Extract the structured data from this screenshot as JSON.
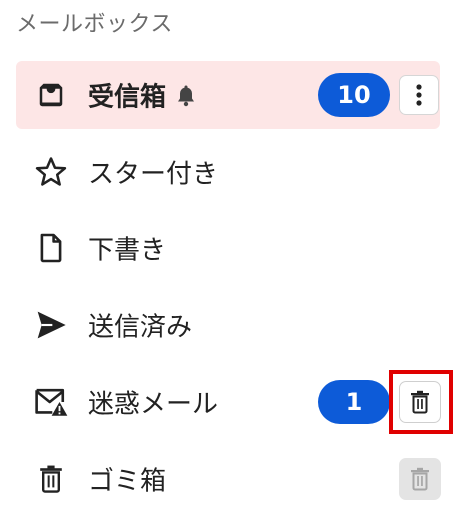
{
  "header": {
    "title": "メールボックス"
  },
  "folders": [
    {
      "label": "受信箱",
      "icon": "inbox-icon",
      "badge": "10",
      "active": true,
      "muted_icon": "bell-icon"
    },
    {
      "label": "スター付き",
      "icon": "star-icon"
    },
    {
      "label": "下書き",
      "icon": "draft-file-icon"
    },
    {
      "label": "送信済み",
      "icon": "send-icon"
    },
    {
      "label": "迷惑メール",
      "icon": "spam-mail-icon",
      "badge": "1"
    },
    {
      "label": "ゴミ箱",
      "icon": "trash-icon"
    }
  ],
  "colors": {
    "active_bg": "#fde6e6",
    "badge_bg": "#0d5bd8",
    "highlight": "#e00000"
  }
}
